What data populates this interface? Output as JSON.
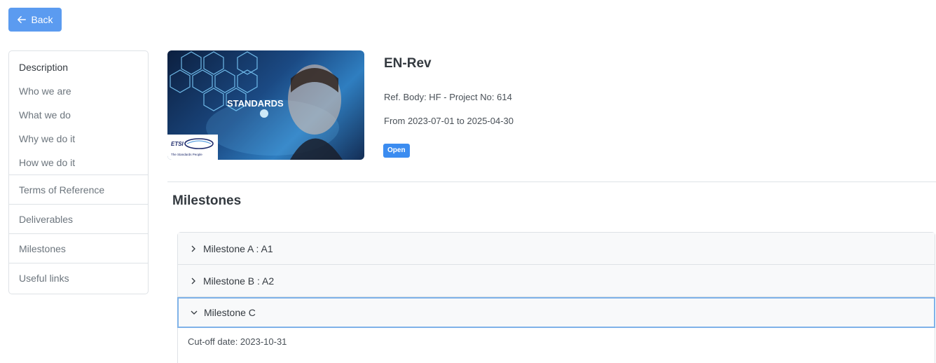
{
  "back_button": {
    "label": "Back"
  },
  "sidebar": {
    "group": [
      {
        "label": "Description"
      },
      {
        "label": "Who we are"
      },
      {
        "label": "What we do"
      },
      {
        "label": "Why we do it"
      },
      {
        "label": "How we do it"
      }
    ],
    "items": [
      {
        "label": "Terms of Reference"
      },
      {
        "label": "Deliverables"
      },
      {
        "label": "Milestones"
      },
      {
        "label": "Useful links"
      }
    ]
  },
  "hero": {
    "banner_text": "STANDARDS",
    "logo_text": "ETSI",
    "logo_tagline": "The Standards People"
  },
  "project": {
    "title": "EN-Rev",
    "reference": "Ref. Body: HF - Project No: 614",
    "dates": "From 2023-07-01 to 2025-04-30",
    "status": "Open"
  },
  "milestones": {
    "heading": "Milestones",
    "items": [
      {
        "label": "Milestone A : A1",
        "expanded": false
      },
      {
        "label": "Milestone B : A2",
        "expanded": false
      },
      {
        "label": "Milestone C",
        "expanded": true,
        "detail": "Cut-off date: 2023-10-31"
      }
    ]
  },
  "colors": {
    "primary": "#5b9bf0",
    "badge": "#3b8cf0",
    "focus_border": "#7fb2e8"
  }
}
